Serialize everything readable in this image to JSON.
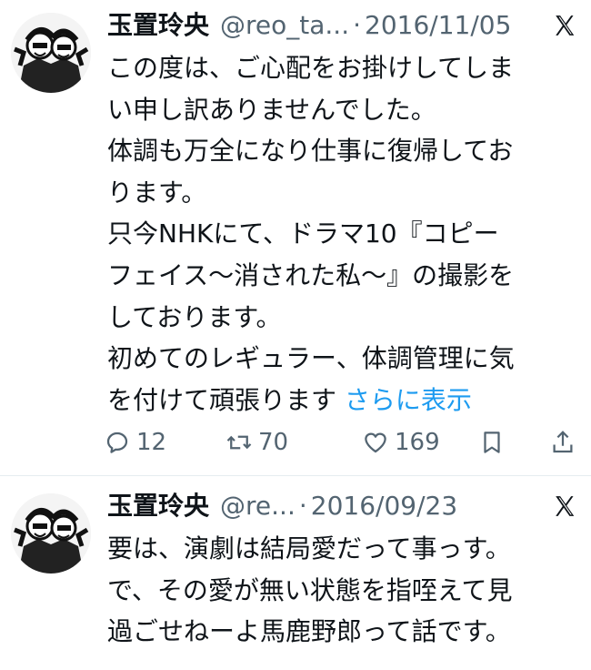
{
  "tweets": [
    {
      "display_name": "玉置玲央",
      "handle": "@reo_ta...",
      "separator": "·",
      "date": "2016/11/05",
      "lines": [
        "この度は、ご心配をお掛けしてしま",
        "い申し訳ありませんでした。",
        "体調も万全になり仕事に復帰してお",
        "ります。",
        "只今NHKにて、ドラマ10『コピー",
        "フェイス〜消された私〜』の撮影を",
        "しております。",
        "初めてのレギュラー、体調管理に気",
        "を付けて頑張ります "
      ],
      "show_more": "さらに表示",
      "replies": "12",
      "retweets": "70",
      "likes": "169"
    },
    {
      "display_name": "玉置玲央",
      "handle": "@re...",
      "separator": "·",
      "date": "2016/09/23",
      "lines": [
        "要は、演劇は結局愛だって事っす。",
        "で、その愛が無い状態を指咥えて見",
        "過ごせねーよ馬鹿野郎って話です。"
      ]
    }
  ],
  "icons": {
    "platform": "x-logo-icon",
    "reply": "reply-icon",
    "retweet": "retweet-icon",
    "like": "heart-icon",
    "bookmark": "bookmark-icon",
    "share": "share-icon"
  },
  "colors": {
    "text": "#0f1419",
    "secondary": "#536471",
    "link": "#1d9bf0"
  }
}
